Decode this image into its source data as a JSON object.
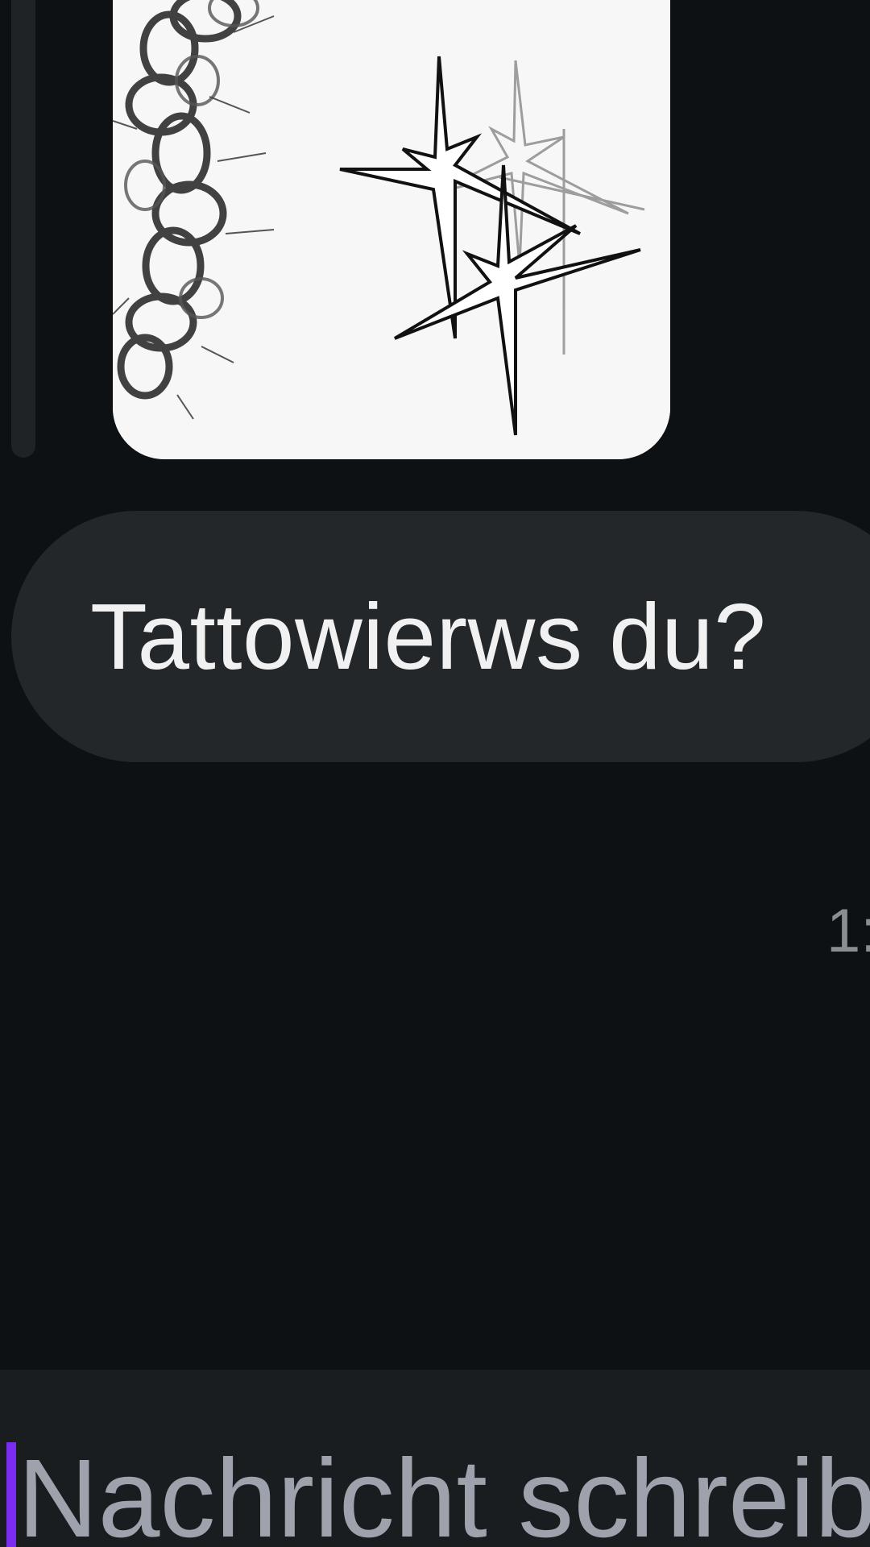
{
  "messages": [
    {
      "type": "image",
      "image_description_icon": "tattoo-sketch-image"
    },
    {
      "type": "text",
      "text": "Tattowierws du?"
    }
  ],
  "timestamp_partial": "1:",
  "composer": {
    "placeholder": "Nachricht schreibe"
  },
  "colors": {
    "background": "#0d1114",
    "bubble": "#232729",
    "composer": "#1a1d1f",
    "caret": "#7b2cf0",
    "placeholder": "#9ea2ad"
  }
}
